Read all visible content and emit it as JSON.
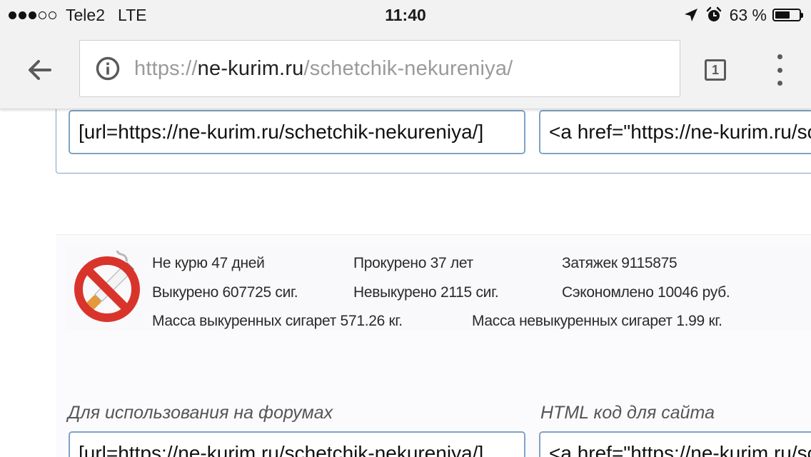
{
  "status_bar": {
    "carrier": "Tele2",
    "network": "LTE",
    "time": "11:40",
    "battery_percent": "63 %",
    "battery_level": 0.63,
    "signal_bars_filled": 3,
    "signal_bars_total": 5,
    "icons": [
      "location-arrow-icon",
      "alarm-clock-icon",
      "battery-icon"
    ]
  },
  "browser": {
    "url_scheme": "https://",
    "url_host": "ne-kurim.ru",
    "url_path": "/schetchik-nekureniya/",
    "tab_count": "1",
    "icons": [
      "back-arrow-icon",
      "info-icon",
      "tabs-icon",
      "overflow-menu-icon"
    ]
  },
  "top_fields": {
    "forum_code": "[url=https://ne-kurim.ru/schetchik-nekureniya/]",
    "html_code": "<a href=\"https://ne-kurim.ru/schetchik-nekureniya/\">"
  },
  "counter": {
    "icon": "no-smoking-icon",
    "stats": {
      "not_smoking": "Не курю 47 дней",
      "smoked_years": "Прокурено 37 лет",
      "puffs": "Затяжек 9115875",
      "smoked_cigs": "Выкурено 607725 сиг.",
      "not_smoked_cigs": "Невыкурено 2115 сиг.",
      "saved": "Сэкономлено 10046 руб.",
      "mass_smoked": "Масса выкуренных сигарет 571.26 кг.",
      "mass_not_smoked": "Масса невыкуренных сигарет 1.99 кг."
    }
  },
  "embed": {
    "forum_label": "Для использования на форумах",
    "html_label": "HTML код для сайта",
    "forum_code": "[url=https://ne-kurim.ru/schetchik-nekureniya/]",
    "html_code": "<a href=\"https://ne-kurim.ru/schetchik-nekureniya/\">"
  },
  "colors": {
    "field_border": "#7fa3c6",
    "chrome_bg": "#f2f2f2",
    "no_smoking_red": "#d9342b"
  }
}
